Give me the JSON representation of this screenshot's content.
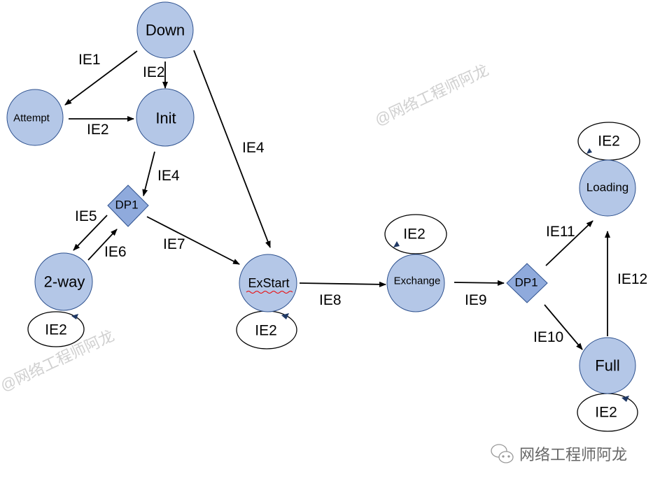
{
  "colors": {
    "node_fill": "#b4c7e7",
    "node_stroke": "#2f528f",
    "decision_fill": "#8faadc"
  },
  "nodes": {
    "down": "Down",
    "attempt": "Attempt",
    "init": "Init",
    "two_way": "2-way",
    "exstart": "ExStart",
    "exchange": "Exchange",
    "loading": "Loading",
    "full": "Full",
    "dp1_a": "DP1",
    "dp1_b": "DP1"
  },
  "edges": {
    "down_attempt": "IE1",
    "down_init": "IE2",
    "attempt_init": "IE2",
    "down_exstart": "IE4",
    "init_dp1": "IE4",
    "dp1_2way": "IE5",
    "twoway_dp1": "IE6",
    "dp1_exstart": "IE7",
    "exstart_exchange": "IE8",
    "exchange_dp1": "IE9",
    "dp1_full": "IE10",
    "dp1_loading": "IE11",
    "full_loading": "IE12"
  },
  "self_loops": {
    "loading": "IE2",
    "exchange": "IE2",
    "two_way": "IE2",
    "exstart": "IE2",
    "full": "IE2"
  },
  "watermarks": [
    "@网络工程师阿龙",
    "@网络工程师阿龙"
  ],
  "footer": {
    "icon": "wechat-icon",
    "text": "网络工程师阿龙"
  }
}
